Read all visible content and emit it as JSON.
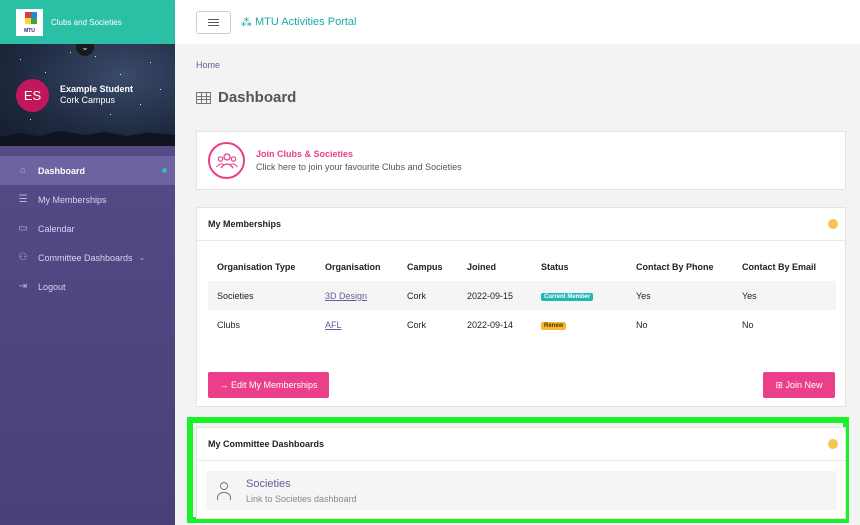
{
  "brand": {
    "logo_text": "MTU",
    "name": "Clubs and Societies"
  },
  "profile": {
    "initials": "ES",
    "name": "Example Student",
    "campus": "Cork Campus"
  },
  "sidebar": {
    "items": [
      {
        "label": "Dashboard",
        "icon": "home-icon",
        "active": true
      },
      {
        "label": "My Memberships",
        "icon": "list-icon"
      },
      {
        "label": "Calendar",
        "icon": "calendar-icon"
      },
      {
        "label": "Committee Dashboards",
        "icon": "user-icon"
      },
      {
        "label": "Logout",
        "icon": "logout-icon"
      }
    ]
  },
  "topbar": {
    "portal_title": "MTU Activities Portal"
  },
  "breadcrumb": "Home",
  "page_title": "Dashboard",
  "join_card": {
    "title": "Join Clubs & Societies",
    "subtitle": "Click here to join your favourite Clubs and Societies"
  },
  "memberships": {
    "title": "My Memberships",
    "columns": [
      "Organisation Type",
      "Organisation",
      "Campus",
      "Joined",
      "Status",
      "Contact By Phone",
      "Contact By Email"
    ],
    "rows": [
      {
        "type": "Societies",
        "organisation": "3D Design",
        "campus": "Cork",
        "joined": "2022-09-15",
        "status": "Current Member",
        "phone": "Yes",
        "email": "Yes"
      },
      {
        "type": "Clubs",
        "organisation": "AFL",
        "campus": "Cork",
        "joined": "2022-09-14",
        "status": "Renew",
        "phone": "No",
        "email": "No"
      }
    ],
    "edit_button": "→ Edit My Memberships",
    "join_button": "⊞ Join New"
  },
  "committee": {
    "title": "My Committee Dashboards",
    "item_title": "Societies",
    "item_subtitle": "Link to Societies dashboard"
  },
  "colors": {
    "accent_teal": "#2bbfa5",
    "pink": "#ec3f8a",
    "sidebar": "#5a4f8c",
    "highlight": "#19f22a"
  }
}
